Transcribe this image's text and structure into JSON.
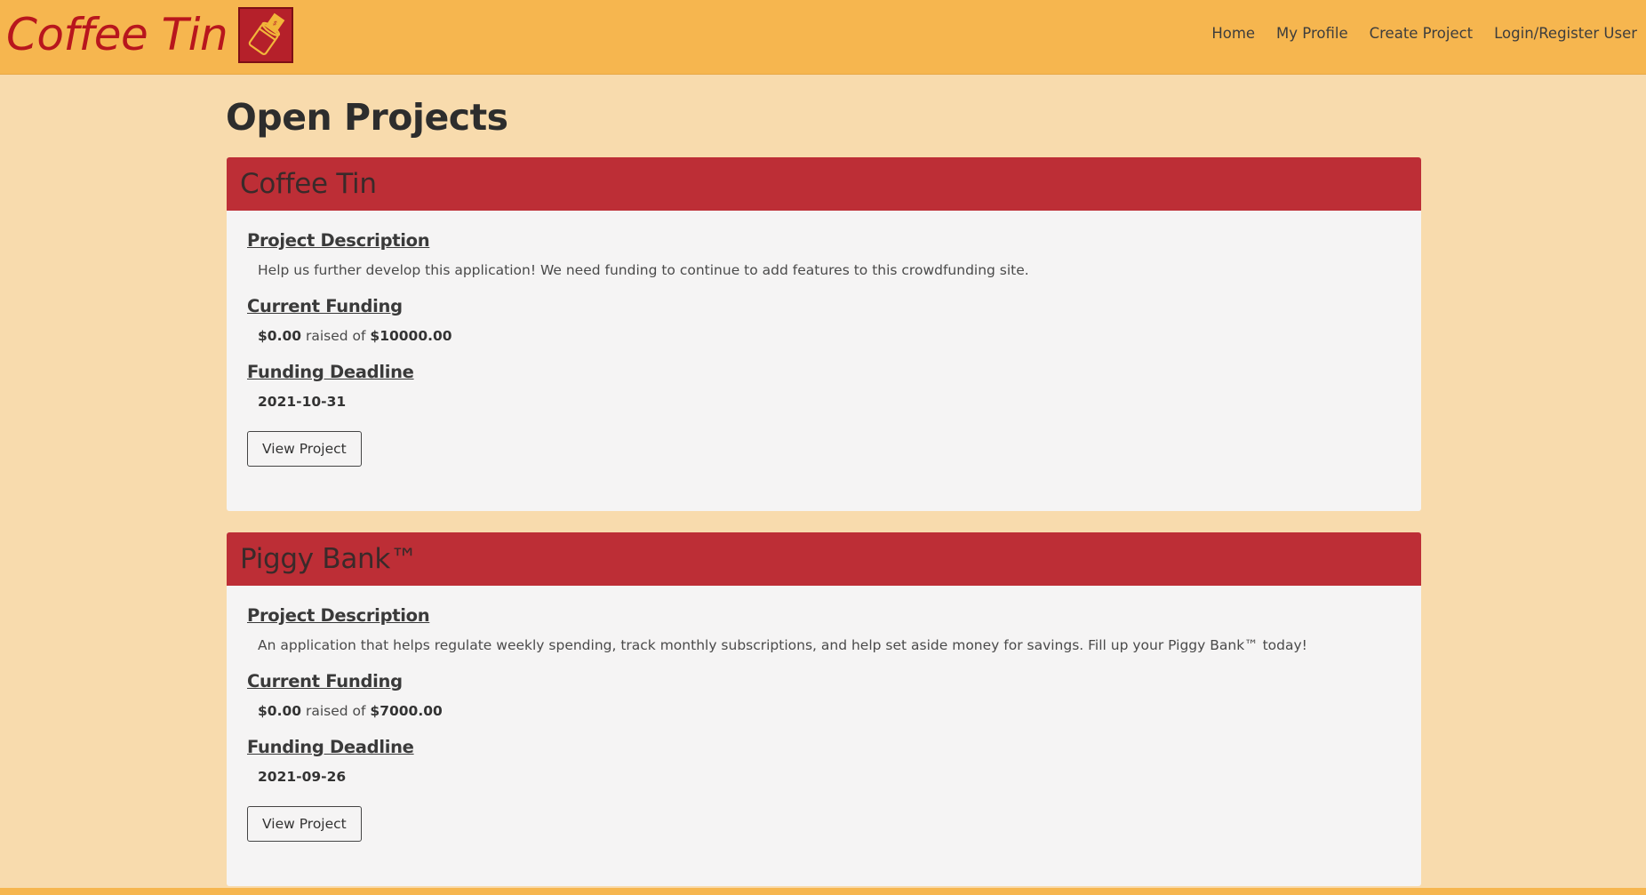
{
  "brand": {
    "name": "Coffee Tin",
    "logo_icon": "coffee-tin-money-icon"
  },
  "nav": {
    "items": [
      {
        "label": "Home"
      },
      {
        "label": "My Profile"
      },
      {
        "label": "Create Project"
      },
      {
        "label": "Login/Register User"
      }
    ]
  },
  "page": {
    "title": "Open Projects"
  },
  "projects": [
    {
      "title": "Coffee Tin",
      "description_label": "Project Description",
      "description": "Help us further develop this application! We need funding to continue to add features to this crowdfunding site.",
      "funding_label": "Current Funding",
      "raised": "$0.00",
      "raised_of": "raised of",
      "goal": "$10000.00",
      "deadline_label": "Funding Deadline",
      "deadline": "2021-10-31",
      "button_label": "View Project"
    },
    {
      "title": "Piggy Bank™",
      "description_label": "Project Description",
      "description": "An application that helps regulate weekly spending, track monthly subscriptions, and help set aside money for savings. Fill up your Piggy Bank™ today!",
      "funding_label": "Current Funding",
      "raised": "$0.00",
      "raised_of": "raised of",
      "goal": "$7000.00",
      "deadline_label": "Funding Deadline",
      "deadline": "2021-09-26",
      "button_label": "View Project"
    }
  ],
  "colors": {
    "navbar": "#f6b64f",
    "background": "#f8dbad",
    "card_header": "#bd2e36",
    "brand_text": "#b8161d"
  }
}
